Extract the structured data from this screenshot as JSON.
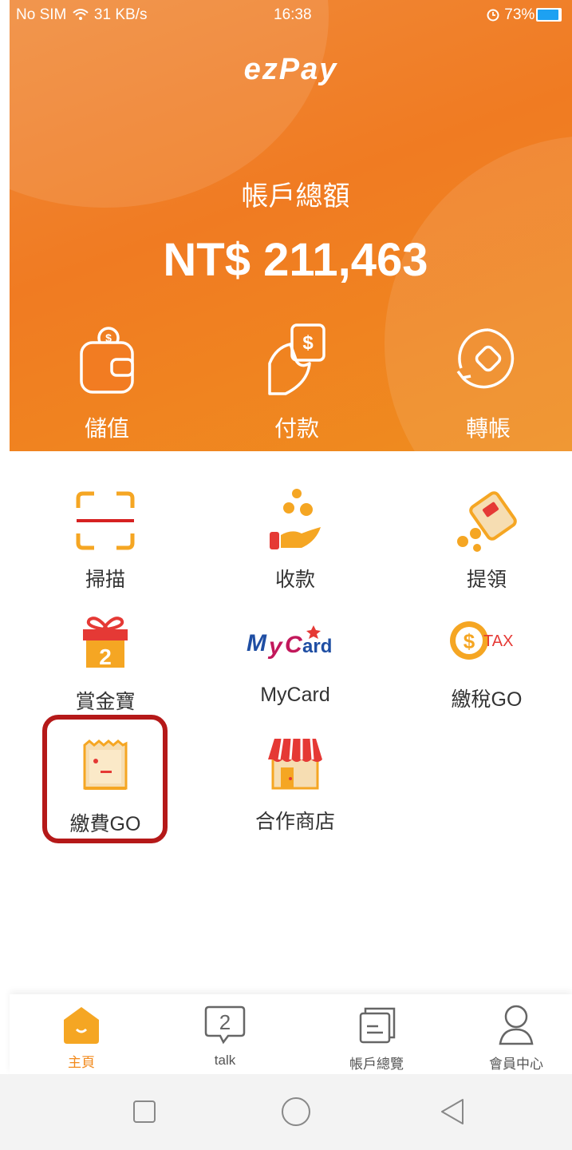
{
  "status_bar": {
    "carrier": "No SIM",
    "speed": "31 KB/s",
    "time": "16:38",
    "battery": "73%"
  },
  "brand": {
    "logo": "ezPay"
  },
  "balance": {
    "label": "帳戶總額",
    "value": "NT$ 211,463"
  },
  "quick_actions": [
    {
      "label": "儲值",
      "icon": "wallet-icon"
    },
    {
      "label": "付款",
      "icon": "payment-icon"
    },
    {
      "label": "轉帳",
      "icon": "transfer-icon"
    }
  ],
  "services": [
    {
      "label": "掃描",
      "icon": "scan-icon"
    },
    {
      "label": "收款",
      "icon": "receive-icon"
    },
    {
      "label": "提領",
      "icon": "withdraw-icon"
    },
    {
      "label": "賞金寶",
      "icon": "gift-icon"
    },
    {
      "label": "MyCard",
      "icon": "mycard-logo"
    },
    {
      "label": "繳稅GO",
      "icon": "tax-icon"
    },
    {
      "label": "繳費GO",
      "icon": "bill-icon"
    },
    {
      "label": "合作商店",
      "icon": "store-icon"
    }
  ],
  "mycard_logo_text": "MyCard",
  "tax_badge_text": "TAX",
  "gift_number": "2",
  "talk_badge": "2",
  "tabbar": [
    {
      "label": "主頁",
      "icon": "home-icon",
      "active": true
    },
    {
      "label": "talk",
      "icon": "talk-icon",
      "active": false
    },
    {
      "label": "帳戶總覽",
      "icon": "account-overview-icon",
      "active": false
    },
    {
      "label": "會員中心",
      "icon": "member-icon",
      "active": false
    }
  ],
  "colors": {
    "primary": "#f07b22",
    "accent": "#f5a623",
    "highlight": "#b51919",
    "text": "#333333"
  }
}
